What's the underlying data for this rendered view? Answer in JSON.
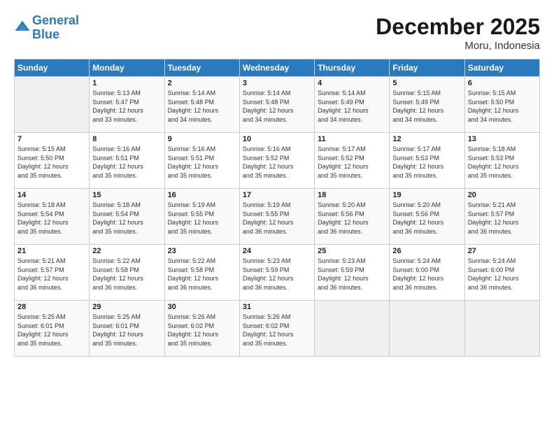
{
  "header": {
    "logo_line1": "General",
    "logo_line2": "Blue",
    "month": "December 2025",
    "location": "Moru, Indonesia"
  },
  "weekdays": [
    "Sunday",
    "Monday",
    "Tuesday",
    "Wednesday",
    "Thursday",
    "Friday",
    "Saturday"
  ],
  "weeks": [
    [
      {
        "num": "",
        "info": ""
      },
      {
        "num": "1",
        "info": "Sunrise: 5:13 AM\nSunset: 5:47 PM\nDaylight: 12 hours\nand 33 minutes."
      },
      {
        "num": "2",
        "info": "Sunrise: 5:14 AM\nSunset: 5:48 PM\nDaylight: 12 hours\nand 34 minutes."
      },
      {
        "num": "3",
        "info": "Sunrise: 5:14 AM\nSunset: 5:48 PM\nDaylight: 12 hours\nand 34 minutes."
      },
      {
        "num": "4",
        "info": "Sunrise: 5:14 AM\nSunset: 5:49 PM\nDaylight: 12 hours\nand 34 minutes."
      },
      {
        "num": "5",
        "info": "Sunrise: 5:15 AM\nSunset: 5:49 PM\nDaylight: 12 hours\nand 34 minutes."
      },
      {
        "num": "6",
        "info": "Sunrise: 5:15 AM\nSunset: 5:50 PM\nDaylight: 12 hours\nand 34 minutes."
      }
    ],
    [
      {
        "num": "7",
        "info": "Sunrise: 5:15 AM\nSunset: 5:50 PM\nDaylight: 12 hours\nand 35 minutes."
      },
      {
        "num": "8",
        "info": "Sunrise: 5:16 AM\nSunset: 5:51 PM\nDaylight: 12 hours\nand 35 minutes."
      },
      {
        "num": "9",
        "info": "Sunrise: 5:16 AM\nSunset: 5:51 PM\nDaylight: 12 hours\nand 35 minutes."
      },
      {
        "num": "10",
        "info": "Sunrise: 5:16 AM\nSunset: 5:52 PM\nDaylight: 12 hours\nand 35 minutes."
      },
      {
        "num": "11",
        "info": "Sunrise: 5:17 AM\nSunset: 5:52 PM\nDaylight: 12 hours\nand 35 minutes."
      },
      {
        "num": "12",
        "info": "Sunrise: 5:17 AM\nSunset: 5:53 PM\nDaylight: 12 hours\nand 35 minutes."
      },
      {
        "num": "13",
        "info": "Sunrise: 5:18 AM\nSunset: 5:53 PM\nDaylight: 12 hours\nand 35 minutes."
      }
    ],
    [
      {
        "num": "14",
        "info": "Sunrise: 5:18 AM\nSunset: 5:54 PM\nDaylight: 12 hours\nand 35 minutes."
      },
      {
        "num": "15",
        "info": "Sunrise: 5:18 AM\nSunset: 5:54 PM\nDaylight: 12 hours\nand 35 minutes."
      },
      {
        "num": "16",
        "info": "Sunrise: 5:19 AM\nSunset: 5:55 PM\nDaylight: 12 hours\nand 35 minutes."
      },
      {
        "num": "17",
        "info": "Sunrise: 5:19 AM\nSunset: 5:55 PM\nDaylight: 12 hours\nand 36 minutes."
      },
      {
        "num": "18",
        "info": "Sunrise: 5:20 AM\nSunset: 5:56 PM\nDaylight: 12 hours\nand 36 minutes."
      },
      {
        "num": "19",
        "info": "Sunrise: 5:20 AM\nSunset: 5:56 PM\nDaylight: 12 hours\nand 36 minutes."
      },
      {
        "num": "20",
        "info": "Sunrise: 5:21 AM\nSunset: 5:57 PM\nDaylight: 12 hours\nand 36 minutes."
      }
    ],
    [
      {
        "num": "21",
        "info": "Sunrise: 5:21 AM\nSunset: 5:57 PM\nDaylight: 12 hours\nand 36 minutes."
      },
      {
        "num": "22",
        "info": "Sunrise: 5:22 AM\nSunset: 5:58 PM\nDaylight: 12 hours\nand 36 minutes."
      },
      {
        "num": "23",
        "info": "Sunrise: 5:22 AM\nSunset: 5:58 PM\nDaylight: 12 hours\nand 36 minutes."
      },
      {
        "num": "24",
        "info": "Sunrise: 5:23 AM\nSunset: 5:59 PM\nDaylight: 12 hours\nand 36 minutes."
      },
      {
        "num": "25",
        "info": "Sunrise: 5:23 AM\nSunset: 5:59 PM\nDaylight: 12 hours\nand 36 minutes."
      },
      {
        "num": "26",
        "info": "Sunrise: 5:24 AM\nSunset: 6:00 PM\nDaylight: 12 hours\nand 36 minutes."
      },
      {
        "num": "27",
        "info": "Sunrise: 5:24 AM\nSunset: 6:00 PM\nDaylight: 12 hours\nand 36 minutes."
      }
    ],
    [
      {
        "num": "28",
        "info": "Sunrise: 5:25 AM\nSunset: 6:01 PM\nDaylight: 12 hours\nand 35 minutes."
      },
      {
        "num": "29",
        "info": "Sunrise: 5:25 AM\nSunset: 6:01 PM\nDaylight: 12 hours\nand 35 minutes."
      },
      {
        "num": "30",
        "info": "Sunrise: 5:26 AM\nSunset: 6:02 PM\nDaylight: 12 hours\nand 35 minutes."
      },
      {
        "num": "31",
        "info": "Sunrise: 5:26 AM\nSunset: 6:02 PM\nDaylight: 12 hours\nand 35 minutes."
      },
      {
        "num": "",
        "info": ""
      },
      {
        "num": "",
        "info": ""
      },
      {
        "num": "",
        "info": ""
      }
    ]
  ]
}
